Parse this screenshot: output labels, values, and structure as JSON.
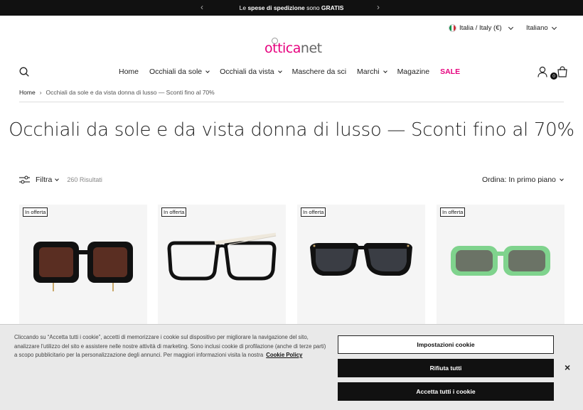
{
  "announcement": {
    "prefix": "Le ",
    "bold1": "spese di spedizione",
    "middle": " sono ",
    "bold2": "GRATIS"
  },
  "header": {
    "locale_label": "Italia / Italy (€)",
    "language_label": "Italiano",
    "logo_part1": "ottica",
    "logo_part2": "net",
    "cart_count": "0"
  },
  "nav": {
    "items": [
      {
        "label": "Home"
      },
      {
        "label": "Occhiali da sole"
      },
      {
        "label": "Occhiali da vista"
      },
      {
        "label": "Maschere da sci"
      },
      {
        "label": "Marchi"
      },
      {
        "label": "Magazine"
      },
      {
        "label": "SALE"
      }
    ]
  },
  "breadcrumb": {
    "home": "Home",
    "separator": "›",
    "current": "Occhiali da sole e da vista donna di lusso — Sconti fino al 70%"
  },
  "page_title": "Occhiali da sole e da vista donna di lusso — Sconti fino al 70%",
  "toolbar": {
    "filter_label": "Filtra",
    "results_count": "260 Risultati",
    "sort_label": "Ordina: In primo piano"
  },
  "products": [
    {
      "badge": "In offerta"
    },
    {
      "badge": "In offerta"
    },
    {
      "badge": "In offerta"
    },
    {
      "badge": "In offerta"
    }
  ],
  "cookie": {
    "text": "Cliccando su “Accetta tutti i cookie”, accetti di memorizzare i cookie sul dispositivo per migliorare la navigazione del sito, analizzare l'utilizzo del sito e assistere nelle nostre attività di marketing. Sono inclusi cookie di profilazione (anche di terze parti) a scopo pubblicitario per la personalizzazione degli annunci. Per maggiori informazioni visita la nostra",
    "policy_link": "Cookie Policy",
    "settings_button": "Impostazioni cookie",
    "reject_button": "Rifiuta tutti",
    "accept_button": "Accetta tutti i cookie",
    "close_symbol": "×"
  },
  "colors": {
    "brand": "#e6007e",
    "dark": "#111111"
  }
}
